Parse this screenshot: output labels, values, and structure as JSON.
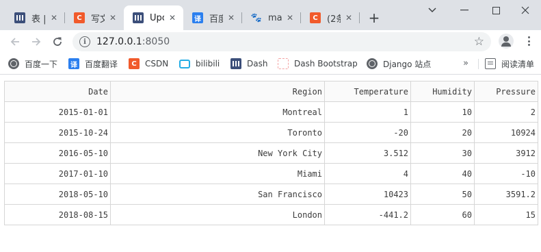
{
  "browser": {
    "tabs": [
      {
        "label": "表 |",
        "icon": "dash-bars-icon"
      },
      {
        "label": "写文",
        "icon": "csdn-icon"
      },
      {
        "label": "Upc",
        "icon": "dash-bars-icon"
      },
      {
        "label": "百度",
        "icon": "translate-icon"
      },
      {
        "label": "mar",
        "icon": "baidu-paw-icon"
      },
      {
        "label": "(2条",
        "icon": "csdn-icon"
      }
    ],
    "active_tab": 2,
    "url_host": "127.0.0.1",
    "url_port": ":8050",
    "bookmarks": [
      {
        "label": "百度一下",
        "icon": "globe-icon"
      },
      {
        "label": "百度翻译",
        "icon": "translate-icon"
      },
      {
        "label": "CSDN",
        "icon": "csdn-icon"
      },
      {
        "label": "bilibili",
        "icon": "bilibili-icon"
      },
      {
        "label": "Dash",
        "icon": "dash-bars-icon"
      },
      {
        "label": "Dash Bootstrap",
        "icon": "dash-bootstrap-icon"
      },
      {
        "label": "Django 站点",
        "icon": "globe-icon"
      }
    ],
    "more_bookmarks": "»",
    "reading_list": "阅读清单"
  },
  "table": {
    "columns": [
      "Date",
      "Region",
      "Temperature",
      "Humidity",
      "Pressure"
    ],
    "rows": [
      [
        "2015-01-01",
        "Montreal",
        "1",
        "10",
        "2"
      ],
      [
        "2015-10-24",
        "Toronto",
        "-20",
        "20",
        "10924"
      ],
      [
        "2016-05-10",
        "New York City",
        "3.512",
        "30",
        "3912"
      ],
      [
        "2017-01-10",
        "Miami",
        "4",
        "40",
        "-10"
      ],
      [
        "2018-05-10",
        "San Francisco",
        "10423",
        "50",
        "3591.2"
      ],
      [
        "2018-08-15",
        "London",
        "-441.2",
        "60",
        "15"
      ]
    ]
  }
}
